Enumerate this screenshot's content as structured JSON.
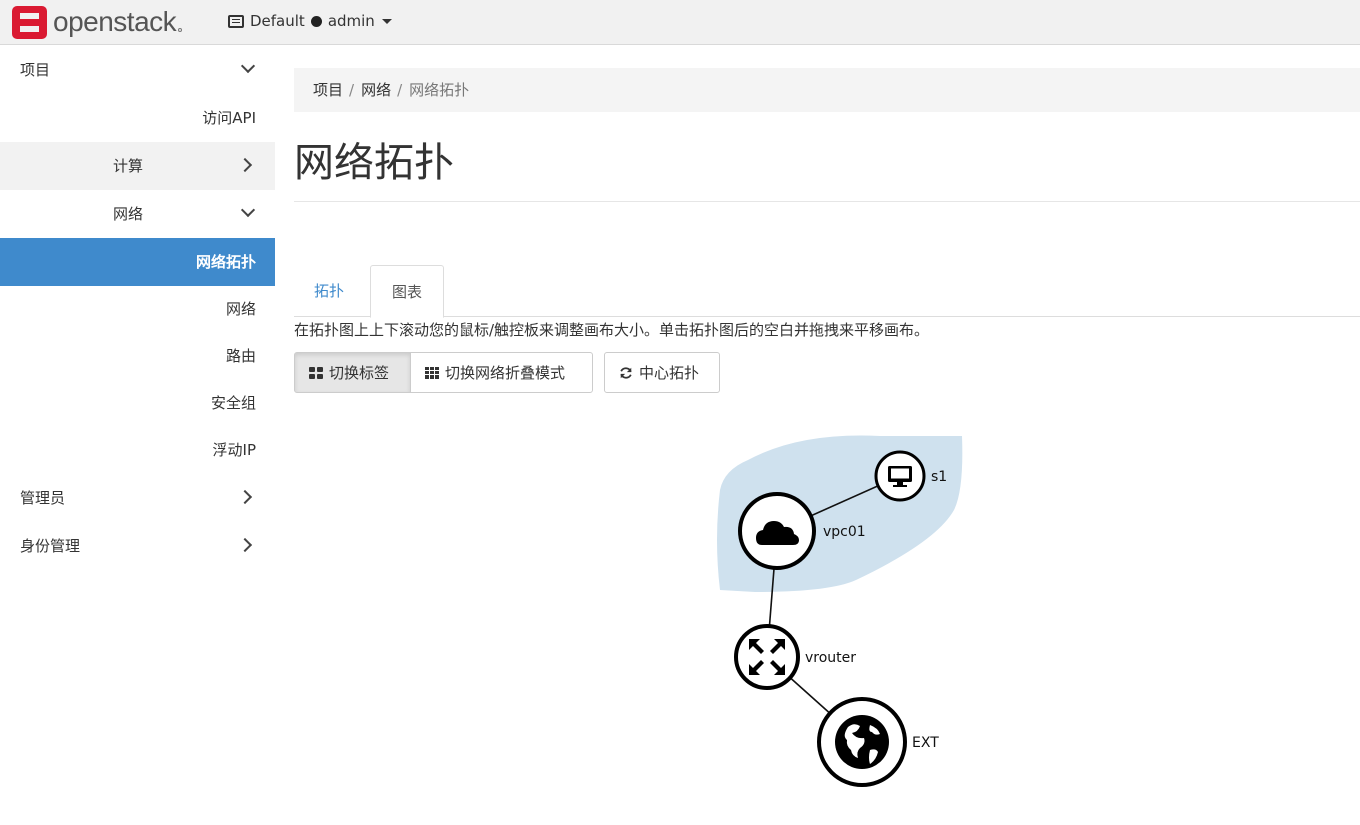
{
  "brand": {
    "name": "openstack"
  },
  "header": {
    "domain": "Default",
    "user": "admin"
  },
  "sidebar": {
    "project": "项目",
    "access_api": "访问API",
    "compute": "计算",
    "network": "网络",
    "network_items": [
      "网络拓扑",
      "网络",
      "路由",
      "安全组",
      "浮动IP"
    ],
    "admin": "管理员",
    "identity": "身份管理"
  },
  "breadcrumb": [
    "项目",
    "网络",
    "网络拓扑"
  ],
  "page": {
    "title": "网络拓扑"
  },
  "tabs": [
    "拓扑",
    "图表"
  ],
  "hint": "在拓扑图上上下滚动您的鼠标/触控板来调整画布大小。单击拓扑图后的空白并拖拽来平移画布。",
  "buttons": {
    "toggle_labels": "切换标签",
    "toggle_collapse": "切换网络折叠模式",
    "center": "中心拓扑"
  },
  "topology": {
    "network": "vpc01",
    "instance": "s1",
    "router": "vrouter",
    "external": "EXT",
    "network_icon": "cloud-icon",
    "instance_icon": "desktop-icon",
    "router_icon": "router-arrows-icon",
    "external_icon": "globe-icon",
    "network_region_color": "#cfe1ee"
  },
  "colors": {
    "accent": "#3f8acc",
    "logo": "#da1a32"
  }
}
